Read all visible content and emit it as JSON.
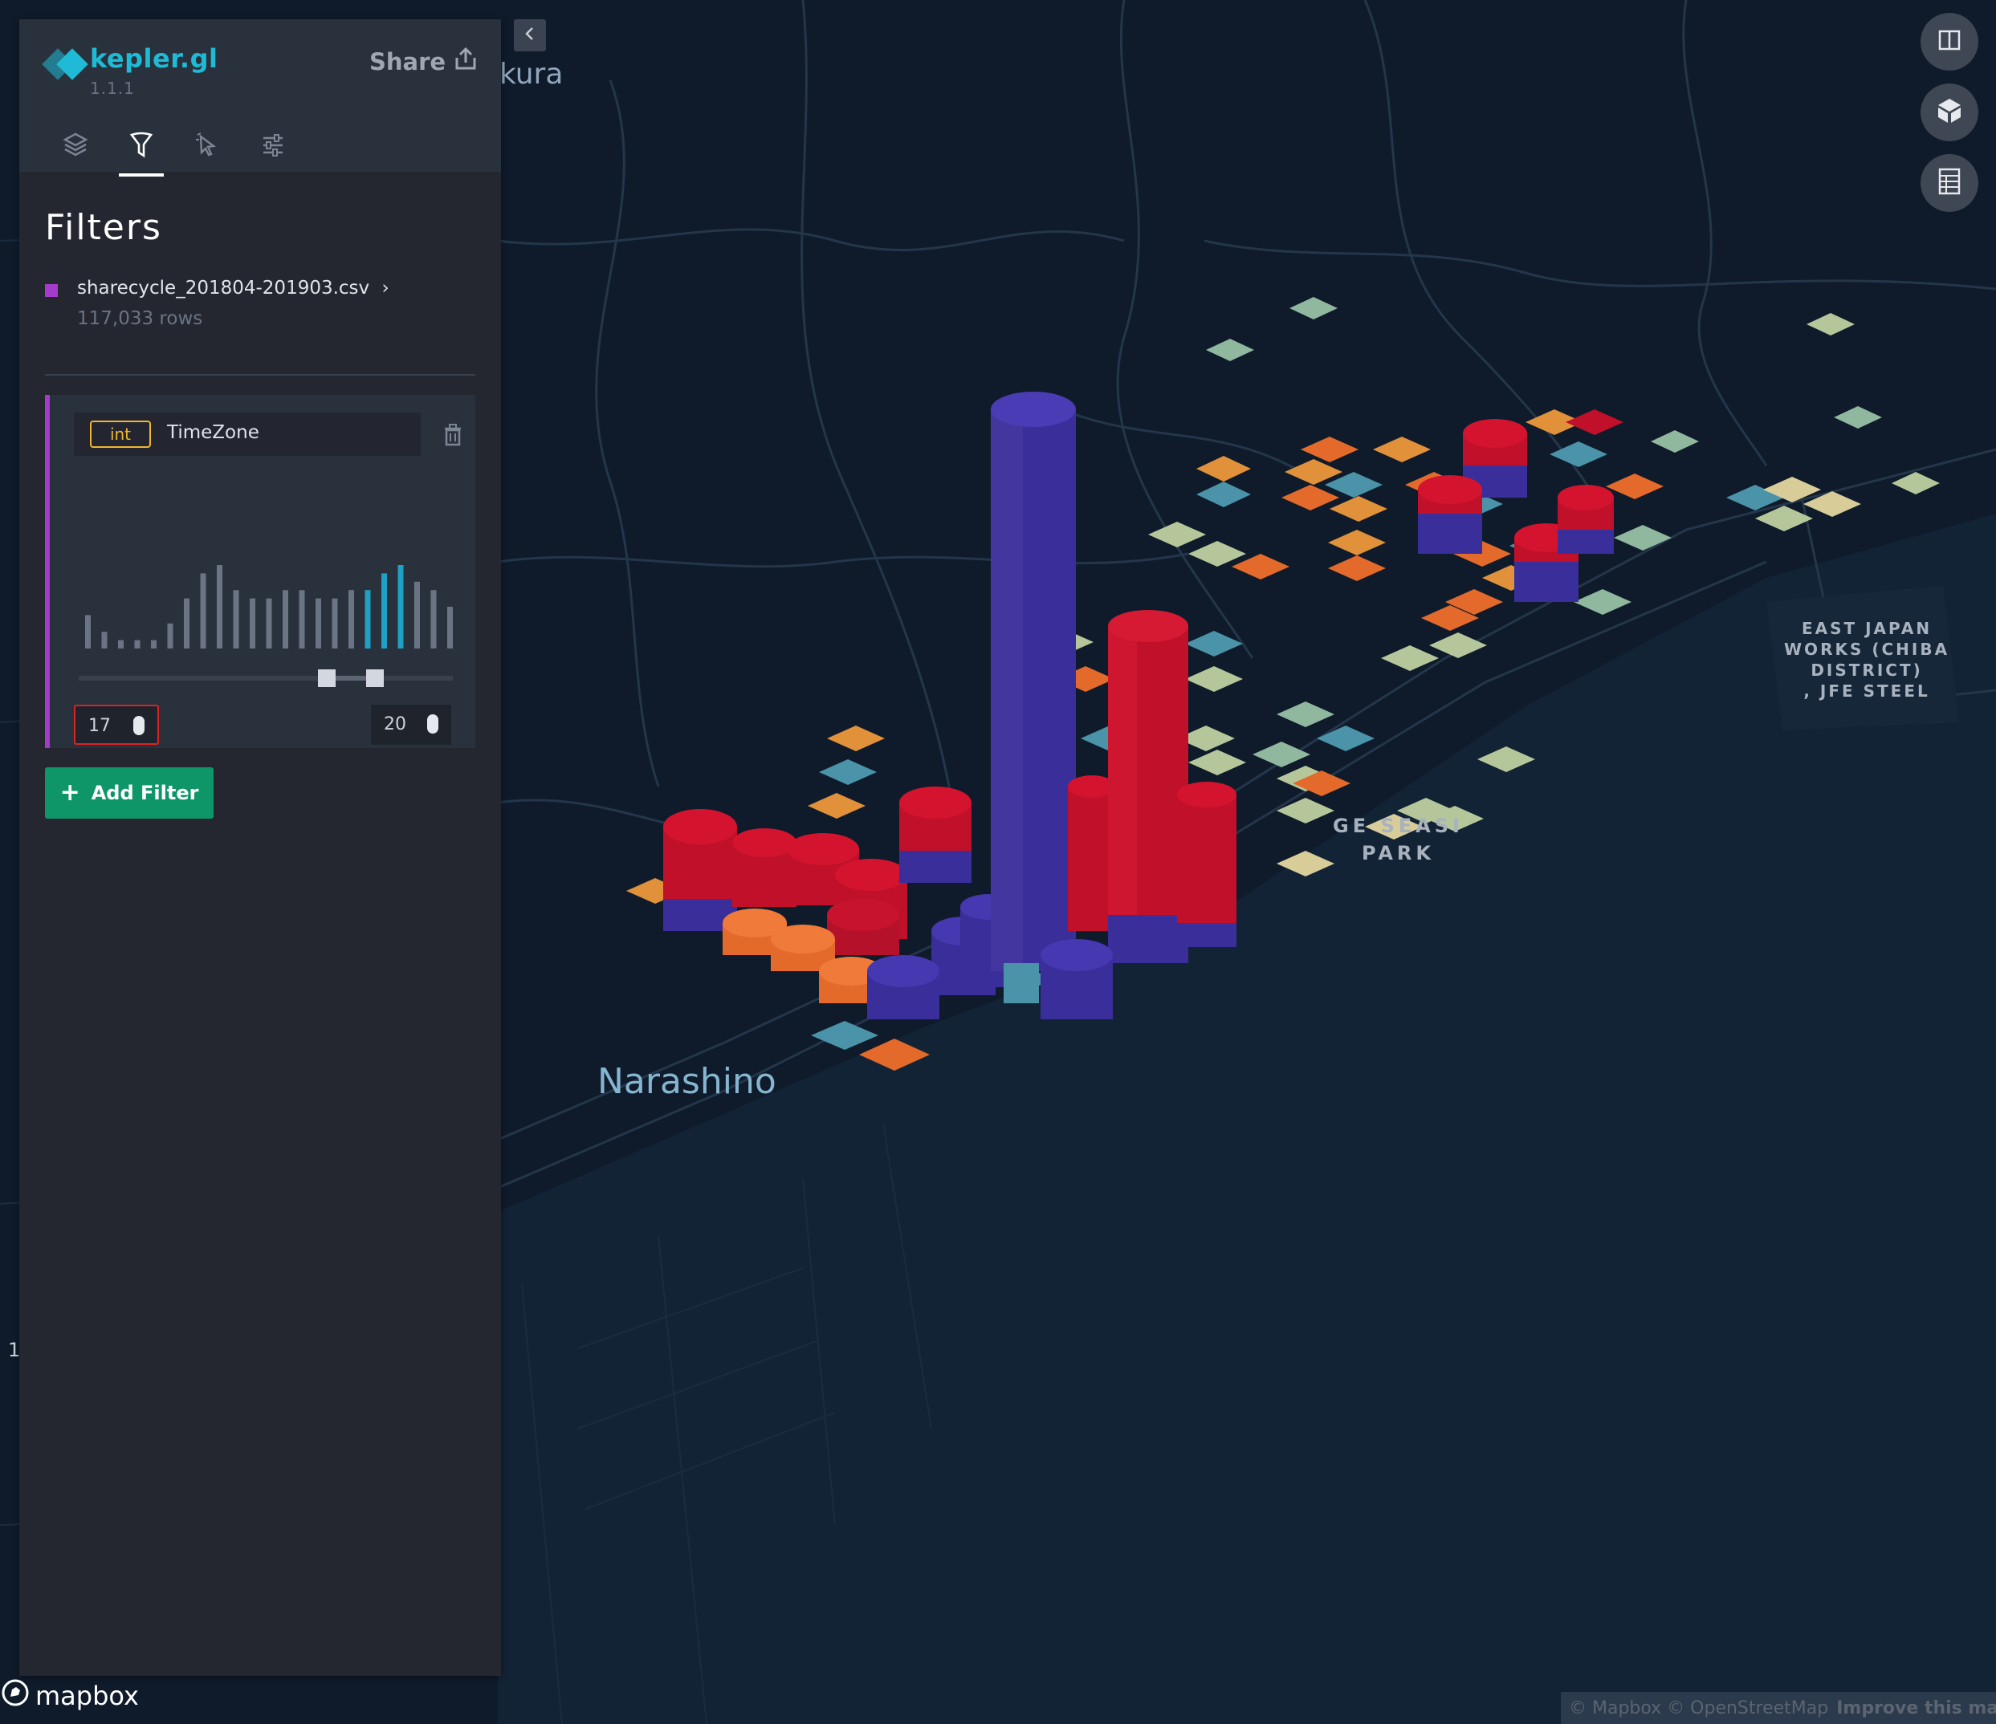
{
  "app": {
    "name": "kepler.gl",
    "version": "1.1.1",
    "share_label": "Share"
  },
  "tabs": [
    {
      "name": "layers",
      "icon": "layers-icon"
    },
    {
      "name": "filters",
      "icon": "filter-icon",
      "active": true
    },
    {
      "name": "interactions",
      "icon": "cursor-icon"
    },
    {
      "name": "map-style",
      "icon": "sliders-icon"
    }
  ],
  "filters_panel": {
    "title": "Filters",
    "dataset": {
      "name": "sharecycle_201804-201903.csv",
      "rows": "117,033 rows",
      "color": "#a33ccb"
    },
    "filter": {
      "type_badge": "int",
      "field": "TimeZone",
      "min_value": "17",
      "max_value": "20",
      "histogram": {
        "counts": [
          4,
          2,
          1,
          1,
          1,
          3,
          6,
          9,
          10,
          7,
          6,
          6,
          7,
          7,
          6,
          6,
          7,
          7,
          9,
          10,
          8,
          7,
          5
        ],
        "selected_range": [
          17,
          20
        ]
      }
    },
    "add_filter_label": "Add Filter"
  },
  "map": {
    "labels": {
      "narashino": "Narashino",
      "kura": "kura",
      "jfe": "EAST JAPAN\nWORKS (CHIBA\nDISTRICT)\n, JFE STEEL",
      "park": "GE SEASI\nPARK",
      "edge_number": "1"
    },
    "controls": [
      "split-map-icon",
      "3d-map-icon",
      "data-table-icon"
    ],
    "colors": {
      "red": "#c0102a",
      "purple": "#3a2e9a",
      "orange": "#e36a2a",
      "teal": "#4a93a8",
      "sand": "#d8cc98",
      "sage": "#8fb89e"
    }
  },
  "attribution": {
    "logo": "mapbox",
    "text": "© Mapbox © OpenStreetMap",
    "improve": "Improve this map"
  }
}
